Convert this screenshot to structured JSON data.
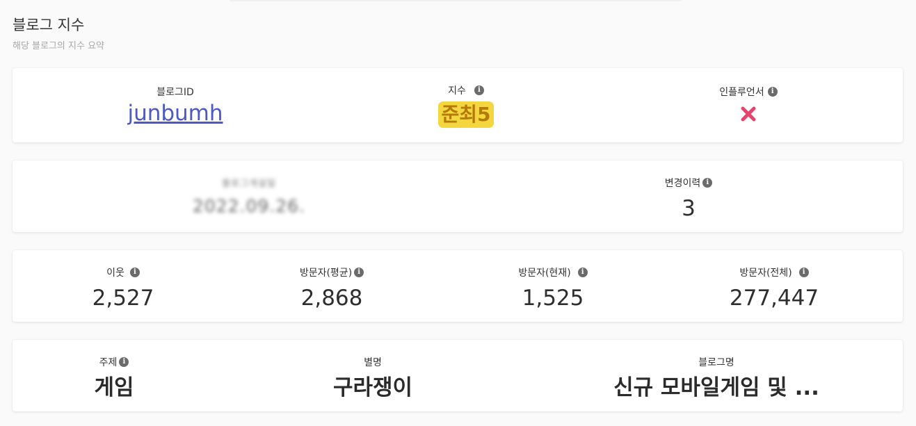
{
  "section": {
    "title": "블로그 지수",
    "subtitle": "해당 블로그의 지수 요약"
  },
  "card1": {
    "blog_id_label": "블로그ID",
    "blog_id_value": "junbumh",
    "index_label": "지수",
    "index_value": "준최5",
    "influencer_label": "인플루언서",
    "influencer_icon": "close-x-icon",
    "influencer_icon_color": "#e8446b"
  },
  "card2": {
    "blurred_label": "블로그개설일",
    "blurred_value": "2022.09.26.",
    "history_label": "변경이력",
    "history_value": "3"
  },
  "card3": {
    "neighbors_label": "이웃",
    "neighbors_value": "2,527",
    "visitors_avg_label": "방문자(평균)",
    "visitors_avg_value": "2,868",
    "visitors_now_label": "방문자(현재)",
    "visitors_now_value": "1,525",
    "visitors_total_label": "방문자(전체)",
    "visitors_total_value": "277,447"
  },
  "card4": {
    "topic_label": "주제",
    "topic_value": "게임",
    "nickname_label": "별명",
    "nickname_value": "구라쟁이",
    "blog_name_label": "블로그명",
    "blog_name_value": "신규 모바일게임 및 ..."
  },
  "colors": {
    "link": "#4b58c6",
    "badge_bg": "#f4d63f",
    "badge_text": "#b47a0a",
    "info_icon": "#6b6b6b"
  }
}
